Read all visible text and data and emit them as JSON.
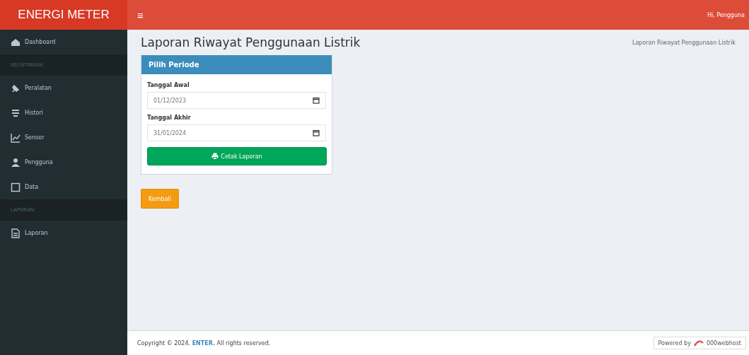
{
  "brand": "ENERGI METER",
  "topbar": {
    "menu_icon": "≡",
    "user": "Hi, Pengguna"
  },
  "sidebar": [
    {
      "kind": "item",
      "label": "Dashboard",
      "selected": false
    },
    {
      "kind": "header",
      "label": "KELISTRIKAN"
    },
    {
      "kind": "item",
      "label": "Peralatan",
      "selected": false
    },
    {
      "kind": "item",
      "label": "Histori",
      "selected": false
    },
    {
      "kind": "item",
      "label": "Sensor",
      "selected": false
    },
    {
      "kind": "item",
      "label": "Pengguna",
      "selected": false
    },
    {
      "kind": "item",
      "label": "Data",
      "selected": false
    },
    {
      "kind": "header",
      "label": "LAPORAN"
    },
    {
      "kind": "item",
      "label": "Laporan",
      "selected": false
    }
  ],
  "page_title": "Laporan Riwayat Penggunaan Listrik",
  "breadcrumb": "Laporan Riwayat Penggunaan Listrik",
  "card": {
    "title": "Pilih Periode",
    "fields": [
      {
        "label": "Tanggal Awal",
        "value": "01/12/2023"
      },
      {
        "label": "Tanggal Akhir",
        "value": "31/01/2024"
      }
    ],
    "submit": "Cetak Laporan"
  },
  "back_button": "Kembali",
  "footer": {
    "text": "Copyright © 2024. **ENTER.** All rights reserved.",
    "powered_by": "Powered by",
    "host": "000webhost"
  }
}
